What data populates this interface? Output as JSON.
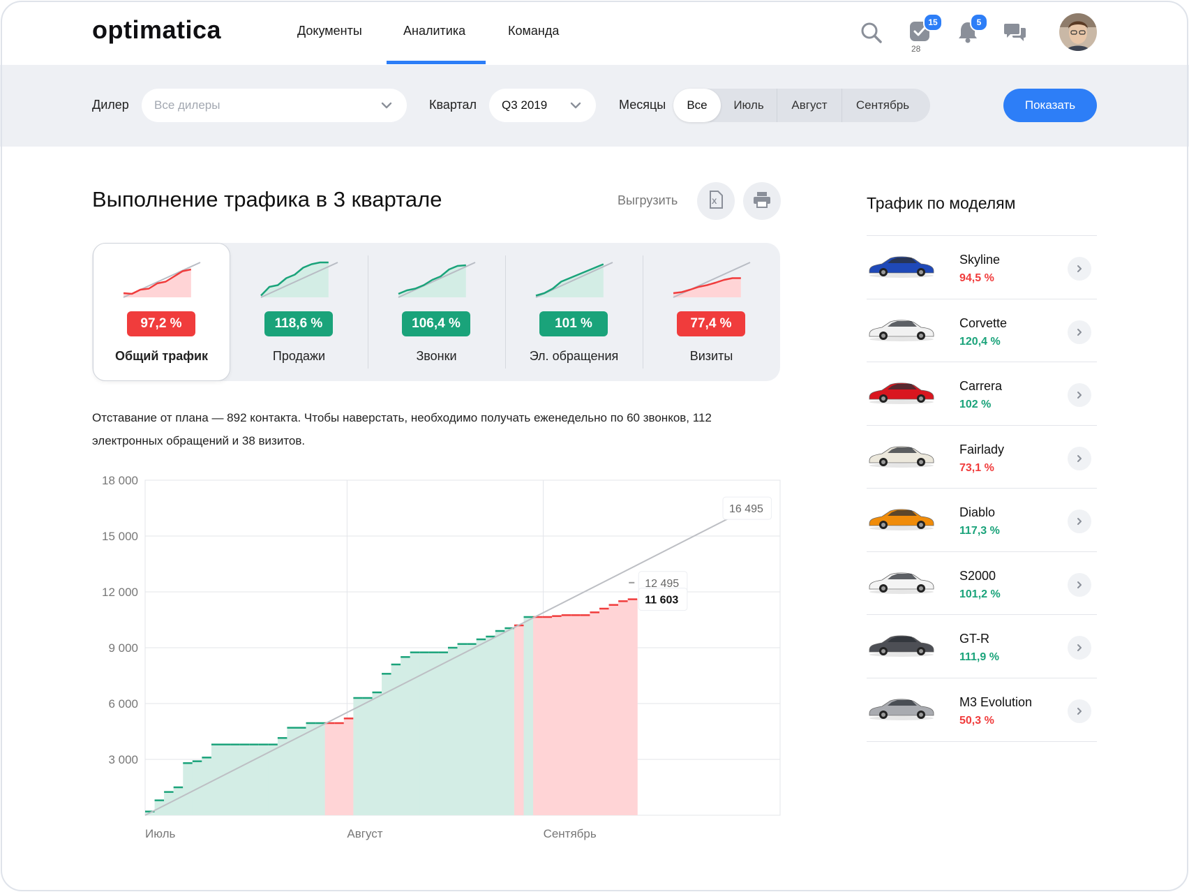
{
  "header": {
    "logo": "optimatica",
    "nav": [
      {
        "label": "Документы"
      },
      {
        "label": "Аналитика",
        "active": true
      },
      {
        "label": "Команда"
      }
    ],
    "tasks_badge": "15",
    "tasks_count": "28",
    "notifications_badge": "5",
    "icons": [
      "search-icon",
      "tasks-check-icon",
      "bell-icon",
      "chat-icon",
      "avatar"
    ]
  },
  "filters": {
    "dealer_label": "Дилер",
    "dealer_placeholder": "Все дилеры",
    "quarter_label": "Квартал",
    "quarter_value": "Q3 2019",
    "months_label": "Месяцы",
    "months": [
      {
        "label": "Все",
        "active": true
      },
      {
        "label": "Июль"
      },
      {
        "label": "Август"
      },
      {
        "label": "Сентябрь"
      }
    ],
    "show_button": "Показать"
  },
  "main": {
    "title": "Выполнение трафика в 3 квартале",
    "export_label": "Выгрузить",
    "kpis": [
      {
        "label": "Общий трафик",
        "value": "97,2 %",
        "status": "red",
        "active": true
      },
      {
        "label": "Продажи",
        "value": "118,6 %",
        "status": "green"
      },
      {
        "label": "Звонки",
        "value": "106,4 %",
        "status": "green"
      },
      {
        "label": "Эл. обращения",
        "value": "101 %",
        "status": "green"
      },
      {
        "label": "Визиты",
        "value": "77,4 %",
        "status": "red"
      }
    ],
    "description": "Отставание от плана — 892 контакта. Чтобы наверстать, необходимо получать еженедельно по 60 звонков, 112 электронных обращений и 38 визитов."
  },
  "colors": {
    "accent": "#2d7ef7",
    "green": "#1aa37a",
    "red": "#f03c3c",
    "green_fill": "#d3ede5",
    "red_fill": "#ffd4d6"
  },
  "chart_data": {
    "type": "line",
    "y_ticks": [
      "18 000",
      "15 000",
      "12 000",
      "9 000",
      "6 000",
      "3 000"
    ],
    "ylim": [
      0,
      18000
    ],
    "x_labels": [
      "Июль",
      "Август",
      "Сентябрь"
    ],
    "plan": {
      "start": 0,
      "end": 16495,
      "end_label": "16 495",
      "current_label": "12 495",
      "current_value": 12495
    },
    "fact_label": "11 603",
    "fact_value": 11603,
    "fact": [
      [
        0,
        200
      ],
      [
        1,
        800
      ],
      [
        2,
        1250
      ],
      [
        3,
        1500
      ],
      [
        4,
        2800
      ],
      [
        5,
        2900
      ],
      [
        6,
        3100
      ],
      [
        7,
        3800
      ],
      [
        8,
        3800
      ],
      [
        9,
        3800
      ],
      [
        10,
        3800
      ],
      [
        11,
        3800
      ],
      [
        12,
        3800
      ],
      [
        13,
        3800
      ],
      [
        14,
        4150
      ],
      [
        15,
        4700
      ],
      [
        16,
        4700
      ],
      [
        17,
        4950
      ],
      [
        18,
        4950
      ],
      [
        19,
        4950
      ],
      [
        20,
        4950
      ],
      [
        21,
        5200
      ],
      [
        22,
        6300
      ],
      [
        23,
        6300
      ],
      [
        24,
        6600
      ],
      [
        25,
        7600
      ],
      [
        26,
        8100
      ],
      [
        27,
        8500
      ],
      [
        28,
        8750
      ],
      [
        29,
        8750
      ],
      [
        30,
        8750
      ],
      [
        31,
        8750
      ],
      [
        32,
        9000
      ],
      [
        33,
        9200
      ],
      [
        34,
        9200
      ],
      [
        35,
        9450
      ],
      [
        36,
        9600
      ],
      [
        37,
        9900
      ],
      [
        38,
        10050
      ],
      [
        39,
        10200
      ],
      [
        40,
        10650
      ],
      [
        41,
        10650
      ],
      [
        42,
        10650
      ],
      [
        43,
        10700
      ],
      [
        44,
        10750
      ],
      [
        45,
        10750
      ],
      [
        46,
        10750
      ],
      [
        47,
        10900
      ],
      [
        48,
        11100
      ],
      [
        49,
        11300
      ],
      [
        50,
        11500
      ],
      [
        51,
        11603
      ]
    ]
  },
  "models_title": "Трафик по моделям",
  "models": [
    {
      "name": "Skyline",
      "value": "94,5 %",
      "status": "red",
      "car_color": "#1f49b8"
    },
    {
      "name": "Corvette",
      "value": "120,4 %",
      "status": "green",
      "car_color": "#f1f1f1"
    },
    {
      "name": "Carrera",
      "value": "102 %",
      "status": "green",
      "car_color": "#d9161f"
    },
    {
      "name": "Fairlady",
      "value": "73,1 %",
      "status": "red",
      "car_color": "#ece8dc"
    },
    {
      "name": "Diablo",
      "value": "117,3 %",
      "status": "green",
      "car_color": "#f08c0a"
    },
    {
      "name": "S2000",
      "value": "101,2 %",
      "status": "green",
      "car_color": "#f4f4f4"
    },
    {
      "name": "GT-R",
      "value": "111,9 %",
      "status": "green",
      "car_color": "#4d4f55"
    },
    {
      "name": "M3 Evolution",
      "value": "50,3 %",
      "status": "red",
      "car_color": "#a9abb0"
    }
  ]
}
